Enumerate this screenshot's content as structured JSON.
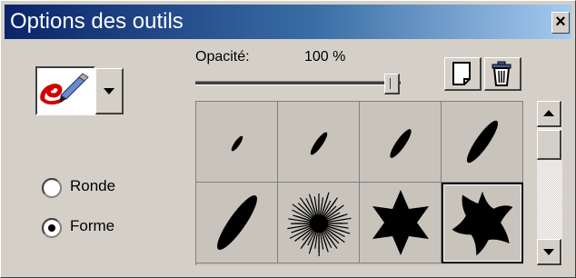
{
  "window": {
    "title": "Options des outils",
    "close_label": "×"
  },
  "tool": {
    "icon": "eraser-brush-icon",
    "dropdown_icon": "chevron-down-icon"
  },
  "shape_options": [
    {
      "label": "Ronde",
      "selected": false
    },
    {
      "label": "Forme",
      "selected": true
    }
  ],
  "opacity": {
    "label": "Opacité:",
    "value_text": "100 %",
    "value": 1.0
  },
  "buttons": {
    "new_icon": "new-page-icon",
    "delete_icon": "trash-icon"
  },
  "brushes": [
    {
      "shape": "ellipse",
      "scale": 0.35
    },
    {
      "shape": "ellipse",
      "scale": 0.5
    },
    {
      "shape": "ellipse",
      "scale": 0.65
    },
    {
      "shape": "ellipse",
      "scale": 0.85
    },
    {
      "shape": "ellipse",
      "scale": 1.0
    },
    {
      "shape": "splat",
      "scale": 1.0
    },
    {
      "shape": "star6",
      "scale": 1.0
    },
    {
      "shape": "swirl-star",
      "scale": 1.0,
      "selected": true
    }
  ],
  "scrollbar": {
    "up_icon": "arrow-up-icon",
    "down_icon": "arrow-down-icon"
  }
}
